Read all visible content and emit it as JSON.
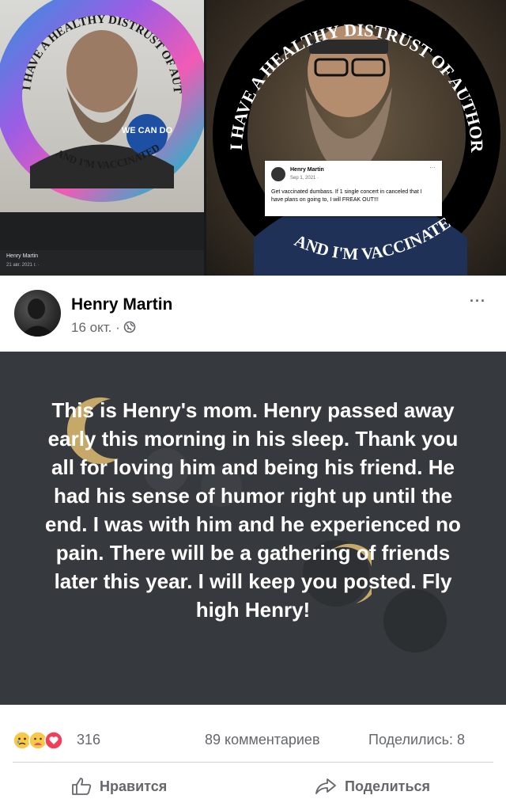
{
  "images": {
    "left_ring_text_top": "I HAVE A HEALTHY DISTRUST OF AUTHORITY",
    "left_ring_text_bottom": "AND I'M VACCINATED",
    "left_badge_text": "WE CAN DO",
    "left_caption_name": "Henry Martin",
    "left_caption_date": "21 авг. 2021 г. · ",
    "right_ring_text_top": "I HAVE A HEALTHY DISTRUST OF AUTHORITY",
    "right_ring_text_bottom": "AND I'M VACCINATED",
    "inset_post": {
      "name": "Henry Martin",
      "date": "Sep 1, 2021 · ",
      "more": "···",
      "text": "Get vaccinated dumbass. If 1 single concert in canceled that I have plans on going to, I will FREAK OUT!!!"
    }
  },
  "post": {
    "author": "Henry Martin",
    "meta": "16 окт. · ",
    "privacy_icon": "globe-icon",
    "more_label": "···",
    "status_text": "This is Henry's mom. Henry passed away early this morning in his sleep. Thank you all for loving him and being his friend. He had his sense of humor right up until the end. I was with him and he experienced no pain. There will be a gathering of friends later this year. I will keep you posted. Fly high Henry!",
    "background_color": "#36393d",
    "accent_color": "#c6a969"
  },
  "stats": {
    "reactions": [
      "sad-reaction-icon",
      "care-reaction-icon",
      "love-reaction-icon"
    ],
    "reaction_count": "316",
    "comments": "89 комментариев",
    "shares": "Поделились: 8"
  },
  "actions": {
    "like_label": "Нравится",
    "share_label": "Поделиться"
  }
}
